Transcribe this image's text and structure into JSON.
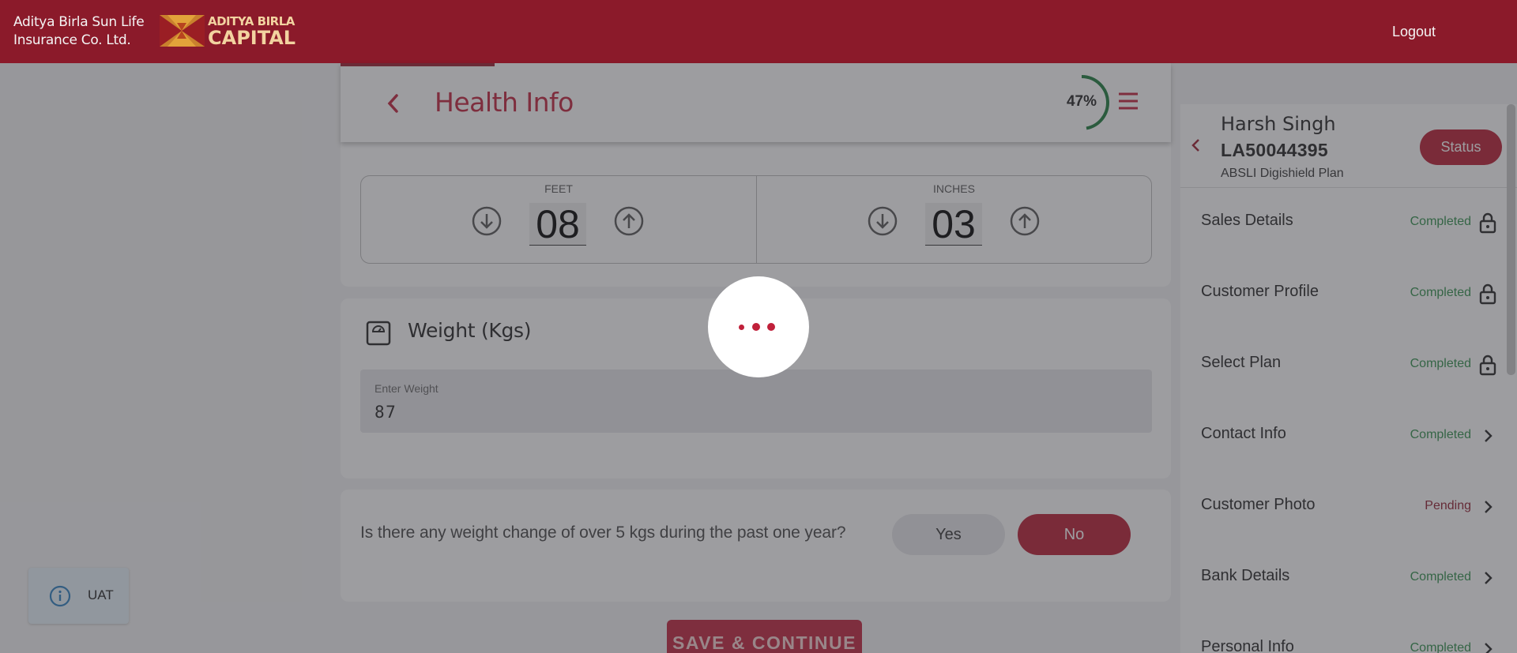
{
  "header": {
    "brand_line1": "Aditya Birla Sun Life",
    "brand_line2": "Insurance Co. Ltd.",
    "logo_line1": "ADITYA BIRLA",
    "logo_line2": "CAPITAL",
    "logout_label": "Logout",
    "brand_color": "#8b1a2a"
  },
  "page": {
    "title": "Health Info",
    "progress_text": "47%",
    "progress_value": 0.47,
    "back_icon": "chevron-left-icon",
    "menu_icon": "hamburger-icon"
  },
  "height": {
    "feet_label": "FEET",
    "feet_value": "08",
    "inches_label": "INCHES",
    "inches_value": "03"
  },
  "weight": {
    "title": "Weight (Kgs)",
    "input_label": "Enter Weight",
    "input_value": "87"
  },
  "question": {
    "text": "Is there any weight change of over 5 kgs during the past one year?",
    "yes_label": "Yes",
    "no_label": "No",
    "selected": "No"
  },
  "save_label": "SAVE & CONTINUE",
  "sidebar": {
    "name": "Harsh Singh",
    "application_id": "LA50044395",
    "plan": "ABSLI Digishield Plan",
    "status_label": "Status",
    "items": [
      {
        "label": "Sales Details",
        "status": "Completed",
        "icon": "lock-icon"
      },
      {
        "label": "Customer Profile",
        "status": "Completed",
        "icon": "lock-icon"
      },
      {
        "label": "Select Plan",
        "status": "Completed",
        "icon": "lock-icon"
      },
      {
        "label": "Contact Info",
        "status": "Completed",
        "icon": "chevron-right-icon"
      },
      {
        "label": "Customer Photo",
        "status": "Pending",
        "icon": "chevron-right-icon"
      },
      {
        "label": "Bank Details",
        "status": "Completed",
        "icon": "chevron-right-icon"
      },
      {
        "label": "Personal Info",
        "status": "Completed",
        "icon": "chevron-right-icon"
      }
    ]
  },
  "env_badge": {
    "label": "UAT",
    "icon": "info-icon"
  },
  "colors": {
    "accent": "#c0203a",
    "completed": "#2f8f4a",
    "pending": "#8f1a2c"
  }
}
